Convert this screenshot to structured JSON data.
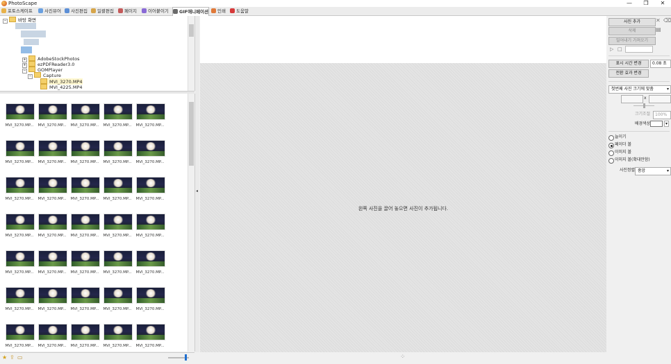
{
  "window": {
    "title": "PhotoScape",
    "minimize": "—",
    "restore": "❐",
    "close": "✕"
  },
  "tabs": [
    {
      "label": "포토스케이프",
      "color": "#e8b24a"
    },
    {
      "label": "사진뷰어",
      "color": "#6aa0e0"
    },
    {
      "label": "사진편집",
      "color": "#5c8fd6"
    },
    {
      "label": "일괄편집",
      "color": "#d6a54a"
    },
    {
      "label": "페이지",
      "color": "#c45a5a"
    },
    {
      "label": "이어붙이기",
      "color": "#8a6ad6"
    },
    {
      "label": "GIF애니메이션",
      "color": "#6a6a6a",
      "active": true
    },
    {
      "label": "인쇄",
      "color": "#e07a3a"
    },
    {
      "label": "도움말",
      "color": "#d63a3a"
    }
  ],
  "tree": {
    "root_label": "바탕 화면",
    "folders": [
      "AdobeStockPhotos",
      "ezPDFReader3.0",
      "GOMPlayer",
      "Capture"
    ],
    "files": [
      "MVI_3270.MP4",
      "MVI_4225.MP4"
    ]
  },
  "thumbnails": {
    "label": "MVI_3270.MP...",
    "count": 35
  },
  "canvas": {
    "message": "왼쪽 사진을 끌어 놓으면 사진이 추가됩니다."
  },
  "right_panel": {
    "add_photo": "사진 추가",
    "delete": "삭제",
    "save": "밀어내기 가져오기",
    "display_time_btn": "표시 시간 변경",
    "display_time_value": "0.08 초",
    "transition_btn": "전환 효과 변경",
    "size_select": "첫번째 사진 크기에 맞춤",
    "x_label": "x",
    "size_adjust_label": "크기조절",
    "size_adjust_value": "100%",
    "bg_color_label": "배경색상",
    "options": [
      {
        "label": "늘이기",
        "checked": false
      },
      {
        "label": "페이더 볼",
        "checked": true
      },
      {
        "label": "이미지 볼",
        "checked": false
      },
      {
        "label": "이미지 볼(확대만함)",
        "checked": false
      }
    ],
    "align_label": "사진정렬",
    "align_value": "중앙"
  }
}
